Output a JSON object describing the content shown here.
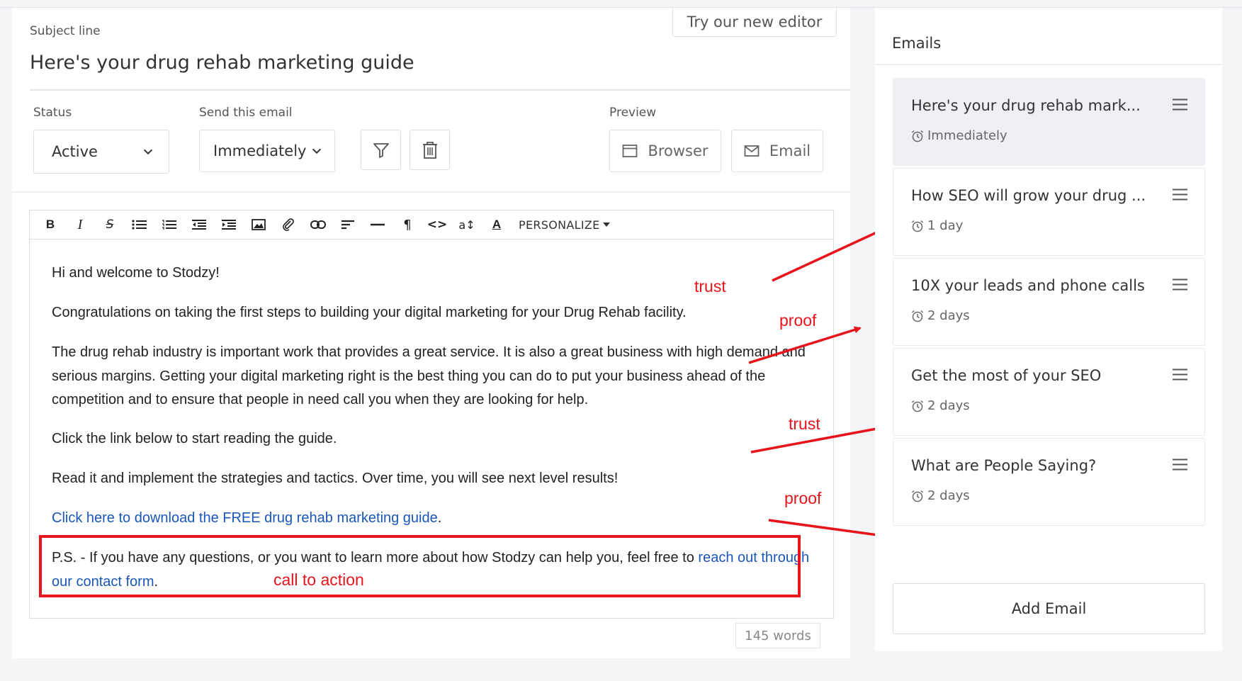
{
  "subject": {
    "label": "Subject line",
    "value": "Here's your drug rehab marketing guide"
  },
  "new_editor_label": "Try our new editor",
  "status": {
    "label": "Status",
    "value": "Active"
  },
  "send": {
    "label": "Send this email",
    "value": "Immediately"
  },
  "preview": {
    "label": "Preview",
    "browser_label": "Browser",
    "email_label": "Email"
  },
  "toolbar": {
    "bold": "B",
    "italic": "I",
    "strike": "S",
    "paragraph": "¶",
    "code": "<>",
    "size": "a↕",
    "font_color": "A",
    "personalize": "PERSONALIZE"
  },
  "body": {
    "p1": "Hi and welcome to Stodzy!",
    "p2": "Congratulations on taking the first steps to building your digital marketing for your Drug Rehab facility.",
    "p3": "The drug rehab industry is important work that provides a great service. It is also a great business with high demand and serious margins. Getting your digital marketing right is the best thing you can do to put your business ahead of the competition and to ensure that people in need call you when they are looking for help.",
    "p4": "Click the link below to start reading the guide.",
    "p5": "Read it and implement the strategies and tactics. Over time, you will see next level results!",
    "p6_link": "Click here to download the FREE drug rehab marketing guide",
    "p6_end": ".",
    "p7_text": "P.S. - If you have any questions, or you want to learn more about how Stodzy can help you, feel free to ",
    "p7_link": "reach out through our contact form",
    "p7_end": "."
  },
  "word_count": "145 words",
  "annotations": {
    "a1": "trust",
    "a2": "proof",
    "a3": "trust",
    "a4": "proof",
    "cta": "call to action"
  },
  "sidebar": {
    "title": "Emails",
    "items": [
      {
        "title": "Here's your drug rehab mark...",
        "delay": "Immediately"
      },
      {
        "title": "How SEO will grow your drug ...",
        "delay": "1 day"
      },
      {
        "title": "10X your leads and phone calls",
        "delay": "2 days"
      },
      {
        "title": "Get the most of your SEO",
        "delay": "2 days"
      },
      {
        "title": "What are People Saying?",
        "delay": "2 days"
      }
    ],
    "add_label": "Add Email"
  },
  "colors": {
    "annotation": "#e8141b",
    "link": "#1a56b8",
    "active_item": "#eef0f4"
  }
}
